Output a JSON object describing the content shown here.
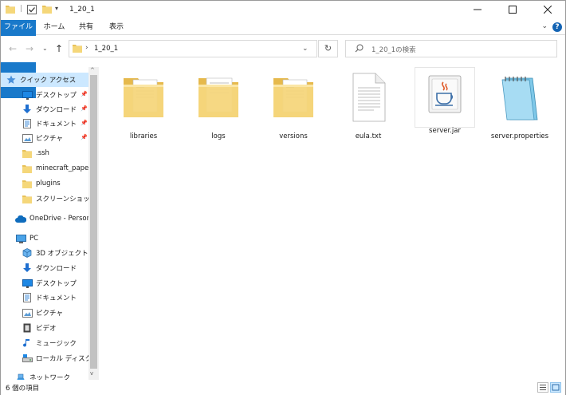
{
  "window": {
    "title": "1_20_1",
    "minimize_icon": "minimize-icon",
    "maximize_icon": "maximize-icon",
    "close_icon": "close-icon"
  },
  "ribbon": {
    "tabs": [
      {
        "label": "ファイル",
        "active": true
      },
      {
        "label": "ホーム"
      },
      {
        "label": "共有"
      },
      {
        "label": "表示"
      }
    ],
    "help": "?",
    "accent_color": "#1979ca"
  },
  "navigation": {
    "address_text": "1_20_1",
    "search_placeholder": "1_20_1の検索"
  },
  "sidebar": {
    "quick_access": {
      "label": "クイック アクセス",
      "items": [
        {
          "label": "デスクトップ",
          "icon": "desktop-icon",
          "pinned": true
        },
        {
          "label": "ダウンロード",
          "icon": "download-icon",
          "pinned": true
        },
        {
          "label": "ドキュメント",
          "icon": "documents-icon",
          "pinned": true
        },
        {
          "label": "ピクチャ",
          "icon": "pictures-icon",
          "pinned": true
        },
        {
          "label": ".ssh",
          "icon": "folder-icon"
        },
        {
          "label": "minecraft_paper",
          "icon": "folder-icon"
        },
        {
          "label": "plugins",
          "icon": "folder-icon"
        },
        {
          "label": "スクリーンショット",
          "icon": "folder-icon"
        }
      ]
    },
    "onedrive": {
      "label": "OneDrive - Person"
    },
    "pc": {
      "label": "PC",
      "items": [
        {
          "label": "3D オブジェクト",
          "icon": "3d-objects-icon"
        },
        {
          "label": "ダウンロード",
          "icon": "download-icon"
        },
        {
          "label": "デスクトップ",
          "icon": "desktop-icon"
        },
        {
          "label": "ドキュメント",
          "icon": "documents-icon"
        },
        {
          "label": "ピクチャ",
          "icon": "pictures-icon"
        },
        {
          "label": "ビデオ",
          "icon": "video-icon"
        },
        {
          "label": "ミュージック",
          "icon": "music-icon"
        },
        {
          "label": "ローカル ディスク (C",
          "icon": "drive-icon"
        }
      ]
    },
    "network": {
      "label": "ネットワーク"
    }
  },
  "files": [
    {
      "name": "libraries",
      "type": "folder-docs"
    },
    {
      "name": "logs",
      "type": "folder-paper"
    },
    {
      "name": "versions",
      "type": "folder-docs"
    },
    {
      "name": "eula.txt",
      "type": "text"
    },
    {
      "name": "server.jar",
      "type": "java"
    },
    {
      "name": "server.properties",
      "type": "notepad"
    }
  ],
  "status": {
    "item_count": "6 個の項目"
  }
}
